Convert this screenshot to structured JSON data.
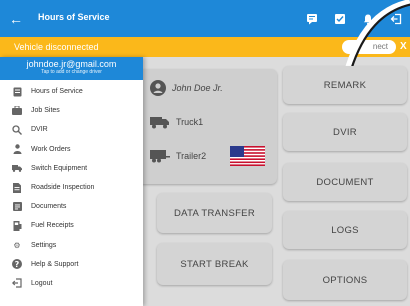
{
  "appbar": {
    "title": "Hours of Service",
    "back_icon": "arrow-left-icon",
    "actions": [
      "remark-icon",
      "certify-icon",
      "notification-icon",
      "logout-icon"
    ],
    "color": "#1e88d8"
  },
  "alert": {
    "message": "Vehicle disconnected",
    "connect_label": "nect",
    "dismiss_label": "X",
    "color": "#fbb81a"
  },
  "drawer": {
    "email": "johndoe.jr@gmail.com",
    "subtitle": "Tap to add or change driver",
    "items": [
      {
        "label": "Hours of Service",
        "icon": "logbook-icon"
      },
      {
        "label": "Job Sites",
        "icon": "briefcase-icon"
      },
      {
        "label": "DVIR",
        "icon": "search-icon"
      },
      {
        "label": "Work Orders",
        "icon": "worker-icon"
      },
      {
        "label": "Switch Equipment",
        "icon": "truck-icon"
      },
      {
        "label": "Roadside Inspection",
        "icon": "document-icon"
      },
      {
        "label": "Documents",
        "icon": "documents-icon"
      },
      {
        "label": "Fuel Receipts",
        "icon": "receipt-icon"
      },
      {
        "label": "Settings",
        "icon": "gear-icon"
      },
      {
        "label": "Help & Support",
        "icon": "help-icon"
      },
      {
        "label": "Logout",
        "icon": "logout-icon"
      }
    ]
  },
  "summary": {
    "driver": "John Doe Jr.",
    "truck": "Truck1",
    "trailer": "Trailer2"
  },
  "buttons": {
    "data_transfer": "DATA TRANSFER",
    "start_break": "START BREAK",
    "remark": "REMARK",
    "dvir": "DVIR",
    "document": "DOCUMENT",
    "logs": "LOGS",
    "options": "OPTIONS"
  }
}
